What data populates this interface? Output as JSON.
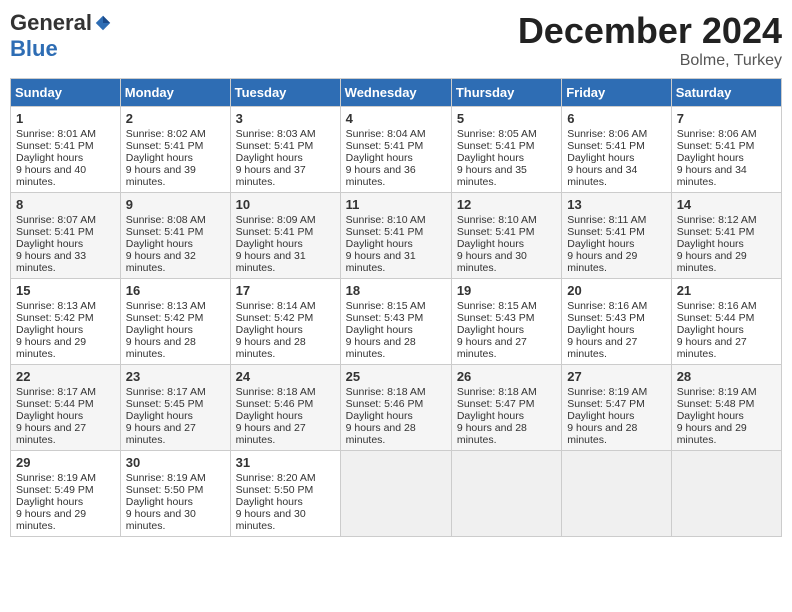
{
  "logo": {
    "general": "General",
    "blue": "Blue"
  },
  "header": {
    "month": "December 2024",
    "location": "Bolme, Turkey"
  },
  "weekdays": [
    "Sunday",
    "Monday",
    "Tuesday",
    "Wednesday",
    "Thursday",
    "Friday",
    "Saturday"
  ],
  "weeks": [
    [
      {
        "day": 1,
        "sunrise": "8:01 AM",
        "sunset": "5:41 PM",
        "daylight": "9 hours and 40 minutes."
      },
      {
        "day": 2,
        "sunrise": "8:02 AM",
        "sunset": "5:41 PM",
        "daylight": "9 hours and 39 minutes."
      },
      {
        "day": 3,
        "sunrise": "8:03 AM",
        "sunset": "5:41 PM",
        "daylight": "9 hours and 37 minutes."
      },
      {
        "day": 4,
        "sunrise": "8:04 AM",
        "sunset": "5:41 PM",
        "daylight": "9 hours and 36 minutes."
      },
      {
        "day": 5,
        "sunrise": "8:05 AM",
        "sunset": "5:41 PM",
        "daylight": "9 hours and 35 minutes."
      },
      {
        "day": 6,
        "sunrise": "8:06 AM",
        "sunset": "5:41 PM",
        "daylight": "9 hours and 34 minutes."
      },
      {
        "day": 7,
        "sunrise": "8:06 AM",
        "sunset": "5:41 PM",
        "daylight": "9 hours and 34 minutes."
      }
    ],
    [
      {
        "day": 8,
        "sunrise": "8:07 AM",
        "sunset": "5:41 PM",
        "daylight": "9 hours and 33 minutes."
      },
      {
        "day": 9,
        "sunrise": "8:08 AM",
        "sunset": "5:41 PM",
        "daylight": "9 hours and 32 minutes."
      },
      {
        "day": 10,
        "sunrise": "8:09 AM",
        "sunset": "5:41 PM",
        "daylight": "9 hours and 31 minutes."
      },
      {
        "day": 11,
        "sunrise": "8:10 AM",
        "sunset": "5:41 PM",
        "daylight": "9 hours and 31 minutes."
      },
      {
        "day": 12,
        "sunrise": "8:10 AM",
        "sunset": "5:41 PM",
        "daylight": "9 hours and 30 minutes."
      },
      {
        "day": 13,
        "sunrise": "8:11 AM",
        "sunset": "5:41 PM",
        "daylight": "9 hours and 29 minutes."
      },
      {
        "day": 14,
        "sunrise": "8:12 AM",
        "sunset": "5:41 PM",
        "daylight": "9 hours and 29 minutes."
      }
    ],
    [
      {
        "day": 15,
        "sunrise": "8:13 AM",
        "sunset": "5:42 PM",
        "daylight": "9 hours and 29 minutes."
      },
      {
        "day": 16,
        "sunrise": "8:13 AM",
        "sunset": "5:42 PM",
        "daylight": "9 hours and 28 minutes."
      },
      {
        "day": 17,
        "sunrise": "8:14 AM",
        "sunset": "5:42 PM",
        "daylight": "9 hours and 28 minutes."
      },
      {
        "day": 18,
        "sunrise": "8:15 AM",
        "sunset": "5:43 PM",
        "daylight": "9 hours and 28 minutes."
      },
      {
        "day": 19,
        "sunrise": "8:15 AM",
        "sunset": "5:43 PM",
        "daylight": "9 hours and 27 minutes."
      },
      {
        "day": 20,
        "sunrise": "8:16 AM",
        "sunset": "5:43 PM",
        "daylight": "9 hours and 27 minutes."
      },
      {
        "day": 21,
        "sunrise": "8:16 AM",
        "sunset": "5:44 PM",
        "daylight": "9 hours and 27 minutes."
      }
    ],
    [
      {
        "day": 22,
        "sunrise": "8:17 AM",
        "sunset": "5:44 PM",
        "daylight": "9 hours and 27 minutes."
      },
      {
        "day": 23,
        "sunrise": "8:17 AM",
        "sunset": "5:45 PM",
        "daylight": "9 hours and 27 minutes."
      },
      {
        "day": 24,
        "sunrise": "8:18 AM",
        "sunset": "5:46 PM",
        "daylight": "9 hours and 27 minutes."
      },
      {
        "day": 25,
        "sunrise": "8:18 AM",
        "sunset": "5:46 PM",
        "daylight": "9 hours and 28 minutes."
      },
      {
        "day": 26,
        "sunrise": "8:18 AM",
        "sunset": "5:47 PM",
        "daylight": "9 hours and 28 minutes."
      },
      {
        "day": 27,
        "sunrise": "8:19 AM",
        "sunset": "5:47 PM",
        "daylight": "9 hours and 28 minutes."
      },
      {
        "day": 28,
        "sunrise": "8:19 AM",
        "sunset": "5:48 PM",
        "daylight": "9 hours and 29 minutes."
      }
    ],
    [
      {
        "day": 29,
        "sunrise": "8:19 AM",
        "sunset": "5:49 PM",
        "daylight": "9 hours and 29 minutes."
      },
      {
        "day": 30,
        "sunrise": "8:19 AM",
        "sunset": "5:50 PM",
        "daylight": "9 hours and 30 minutes."
      },
      {
        "day": 31,
        "sunrise": "8:20 AM",
        "sunset": "5:50 PM",
        "daylight": "9 hours and 30 minutes."
      },
      null,
      null,
      null,
      null
    ]
  ]
}
